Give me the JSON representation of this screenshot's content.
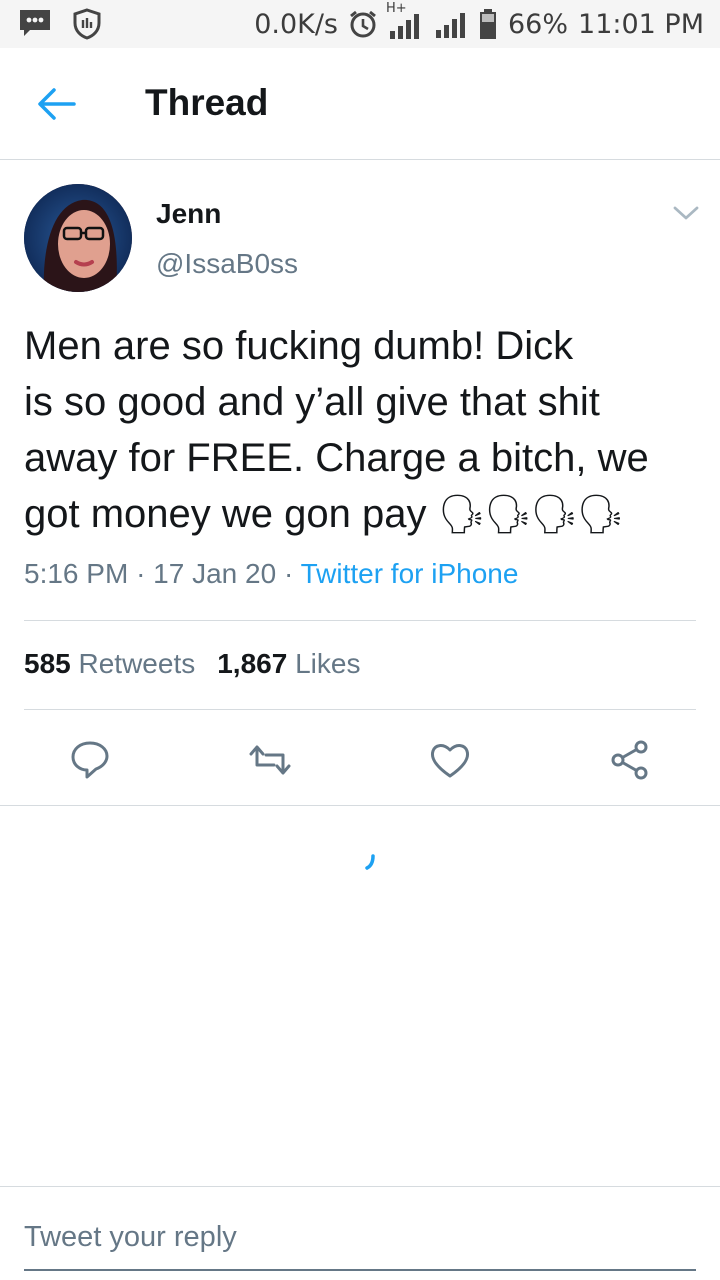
{
  "status_bar": {
    "net_speed": "0.0K/s",
    "network_type": "H+",
    "battery": "66%",
    "time": "11:01 PM",
    "icons": [
      "message-icon",
      "shield-icon",
      "alarm-icon",
      "signal-icon",
      "signal-icon",
      "battery-icon"
    ]
  },
  "header": {
    "title": "Thread",
    "back_icon": "arrow-left-icon"
  },
  "tweet": {
    "author_name": "Jenn",
    "author_handle": "@IssaB0ss",
    "text_lines": [
      "Men are so fucking dumb! Dick",
      "is so good and y’all give that shit",
      "away for FREE. Charge a bitch, we",
      "got money we gon pay"
    ],
    "emoji": "🗣🗣🗣🗣",
    "time": "5:16 PM",
    "separator": "·",
    "date": "17 Jan 20",
    "source": "Twitter for iPhone",
    "retweets_count": "585",
    "retweets_label": "Retweets",
    "likes_count": "1,867",
    "likes_label": "Likes"
  },
  "actions": [
    {
      "icon": "reply-icon"
    },
    {
      "icon": "retweet-icon"
    },
    {
      "icon": "like-icon"
    },
    {
      "icon": "share-icon"
    }
  ],
  "reply": {
    "placeholder": "Tweet your reply"
  },
  "colors": {
    "accent": "#1da1f2",
    "text": "#14171a",
    "secondary": "#657786",
    "divider": "#d6dbdf"
  }
}
